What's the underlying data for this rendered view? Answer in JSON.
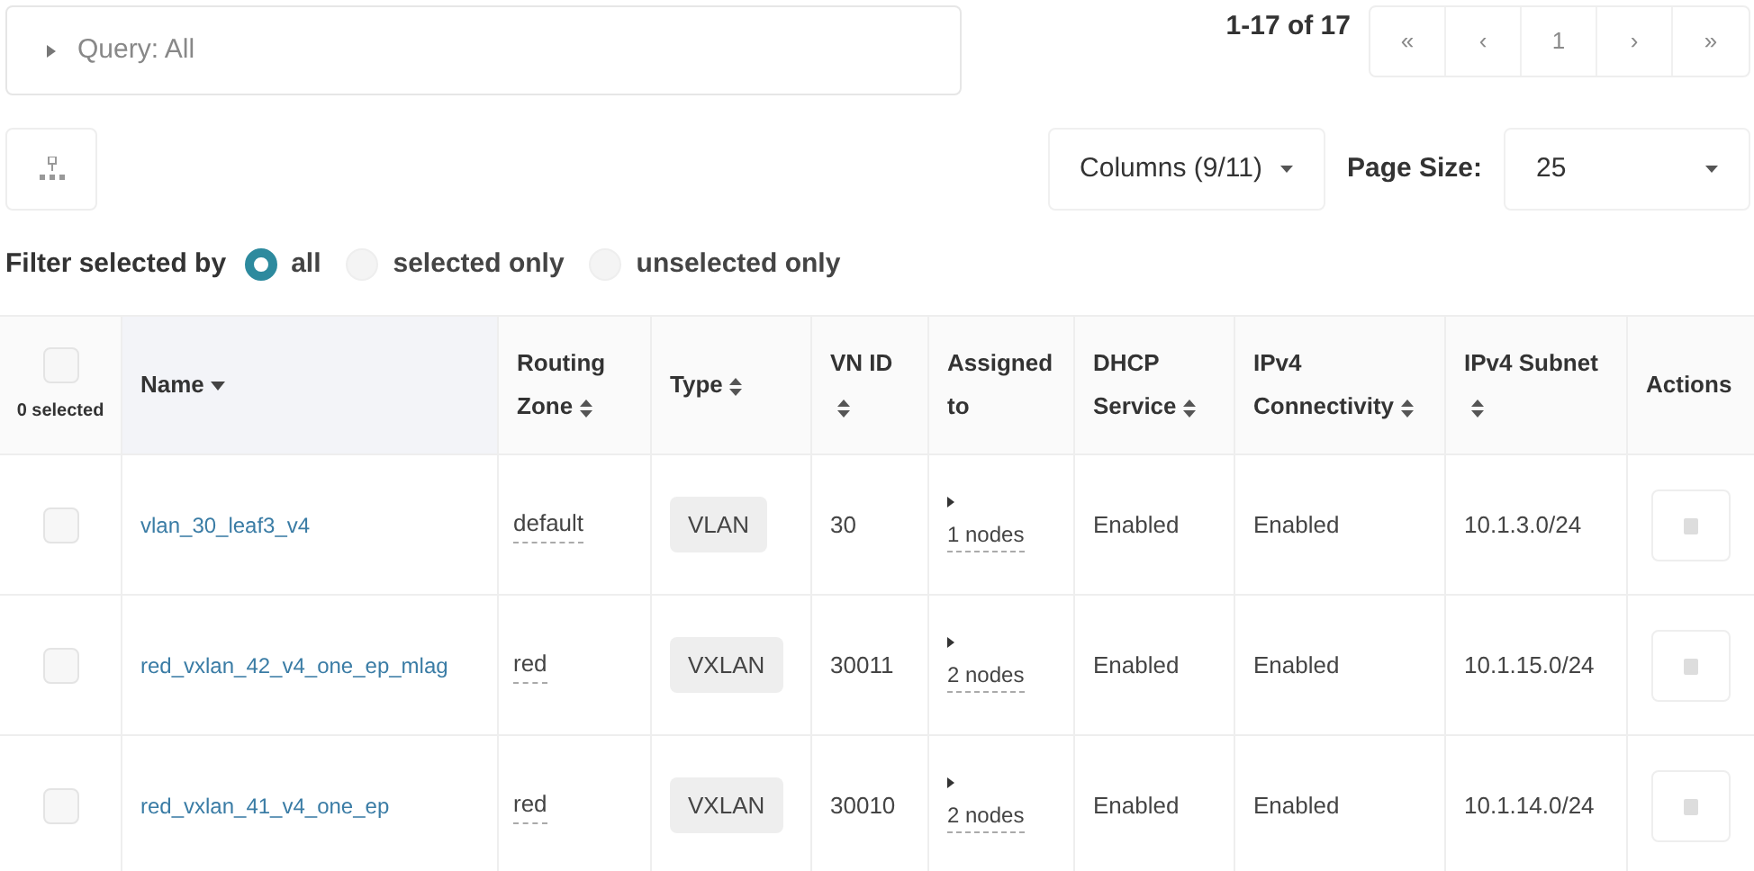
{
  "query": {
    "label": "Query: All",
    "expanded": false
  },
  "pagination": {
    "range": "1-17 of 17",
    "buttons": [
      "«",
      "‹",
      "1",
      "›",
      "»"
    ]
  },
  "columns_button": "Columns (9/11)",
  "page_size": {
    "label": "Page Size:",
    "value": "25"
  },
  "filter": {
    "label": "Filter selected by",
    "options": [
      {
        "label": "all",
        "selected": true
      },
      {
        "label": "selected only",
        "selected": false
      },
      {
        "label": "unselected only",
        "selected": false
      }
    ]
  },
  "table": {
    "select_all": {
      "checked": false,
      "label": "0 selected"
    },
    "columns": [
      {
        "label": "Name",
        "sortable": true,
        "sorted": true
      },
      {
        "label": "Routing Zone",
        "sortable": true,
        "sorted": false
      },
      {
        "label": "Type",
        "sortable": true,
        "sorted": false
      },
      {
        "label": "VN ID",
        "sortable": true,
        "sorted": false
      },
      {
        "label": "Assigned to",
        "sortable": false,
        "sorted": false
      },
      {
        "label": "DHCP Service",
        "sortable": true,
        "sorted": false
      },
      {
        "label": "IPv4 Connectivity",
        "sortable": true,
        "sorted": false
      },
      {
        "label": "IPv4 Subnet",
        "sortable": true,
        "sorted": false
      },
      {
        "label": "Actions",
        "sortable": false,
        "sorted": false
      }
    ],
    "rows": [
      {
        "checked": false,
        "name": "vlan_30_leaf3_v4",
        "routing_zone": "default",
        "type": "VLAN",
        "vn_id": "30",
        "assigned": "1 nodes",
        "dhcp": "Enabled",
        "ipv4": "Enabled",
        "subnet": "10.1.3.0/24"
      },
      {
        "checked": false,
        "name": "red_vxlan_42_v4_one_ep_mlag",
        "routing_zone": "red",
        "type": "VXLAN",
        "vn_id": "30011",
        "assigned": "2 nodes",
        "dhcp": "Enabled",
        "ipv4": "Enabled",
        "subnet": "10.1.15.0/24"
      },
      {
        "checked": false,
        "name": "red_vxlan_41_v4_one_ep",
        "routing_zone": "red",
        "type": "VXLAN",
        "vn_id": "30010",
        "assigned": "2 nodes",
        "dhcp": "Enabled",
        "ipv4": "Enabled",
        "subnet": "10.1.14.0/24"
      }
    ]
  }
}
